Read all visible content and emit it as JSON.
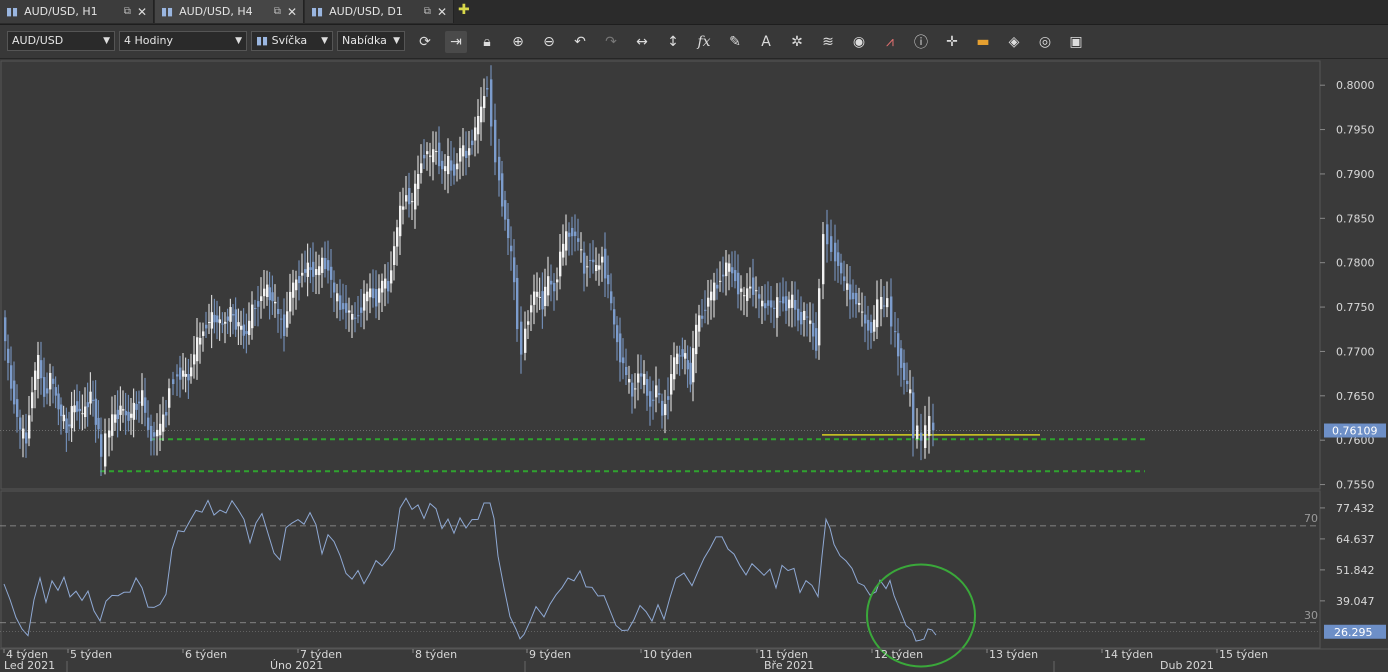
{
  "tabs": [
    {
      "label": "AUD/USD, H1"
    },
    {
      "label": "AUD/USD, H4"
    },
    {
      "label": "AUD/USD, D1"
    }
  ],
  "toolbar": {
    "symbol": "AUD/USD",
    "timeframe": "4 Hodiny",
    "chart_type": "Svíčka",
    "price_side": "Nabídka"
  },
  "chart_data": [
    {
      "type": "candlestick",
      "price_ticks": [
        "0.8000",
        "0.7950",
        "0.7900",
        "0.7850",
        "0.7800",
        "0.7750",
        "0.7700",
        "0.7650",
        "0.7600",
        "0.7550"
      ],
      "ylim": [
        0.7545,
        0.8025
      ],
      "current_price": "0.76109",
      "close_path": [
        [
          0,
          0.774
        ],
        [
          6,
          0.768
        ],
        [
          12,
          0.7645
        ],
        [
          18,
          0.761
        ],
        [
          24,
          0.76
        ],
        [
          30,
          0.766
        ],
        [
          36,
          0.769
        ],
        [
          42,
          0.765
        ],
        [
          48,
          0.7672
        ],
        [
          56,
          0.7638
        ],
        [
          64,
          0.7612
        ],
        [
          72,
          0.764
        ],
        [
          80,
          0.7628
        ],
        [
          88,
          0.7652
        ],
        [
          96,
          0.7612
        ],
        [
          100,
          0.7576
        ],
        [
          104,
          0.7602
        ],
        [
          110,
          0.7622
        ],
        [
          118,
          0.7636
        ],
        [
          126,
          0.7625
        ],
        [
          134,
          0.764
        ],
        [
          140,
          0.765
        ],
        [
          146,
          0.7608
        ],
        [
          152,
          0.7606
        ],
        [
          158,
          0.7614
        ],
        [
          164,
          0.7635
        ],
        [
          168,
          0.766
        ],
        [
          172,
          0.7672
        ],
        [
          178,
          0.7676
        ],
        [
          186,
          0.767
        ],
        [
          192,
          0.7698
        ],
        [
          198,
          0.7716
        ],
        [
          204,
          0.7732
        ],
        [
          212,
          0.7738
        ],
        [
          220,
          0.773
        ],
        [
          228,
          0.7744
        ],
        [
          236,
          0.7728
        ],
        [
          244,
          0.772
        ],
        [
          250,
          0.7746
        ],
        [
          256,
          0.7756
        ],
        [
          262,
          0.777
        ],
        [
          270,
          0.776
        ],
        [
          276,
          0.774
        ],
        [
          282,
          0.7726
        ],
        [
          288,
          0.7766
        ],
        [
          294,
          0.7778
        ],
        [
          300,
          0.779
        ],
        [
          308,
          0.7794
        ],
        [
          314,
          0.7788
        ],
        [
          320,
          0.78
        ],
        [
          326,
          0.7796
        ],
        [
          332,
          0.7764
        ],
        [
          338,
          0.7752
        ],
        [
          344,
          0.7748
        ],
        [
          350,
          0.7736
        ],
        [
          356,
          0.7742
        ],
        [
          362,
          0.776
        ],
        [
          368,
          0.7768
        ],
        [
          374,
          0.7758
        ],
        [
          380,
          0.7778
        ],
        [
          386,
          0.7772
        ],
        [
          392,
          0.782
        ],
        [
          398,
          0.7856
        ],
        [
          404,
          0.7878
        ],
        [
          410,
          0.7866
        ],
        [
          416,
          0.79
        ],
        [
          422,
          0.7926
        ],
        [
          428,
          0.7918
        ],
        [
          434,
          0.7928
        ],
        [
          440,
          0.7904
        ],
        [
          446,
          0.7912
        ],
        [
          452,
          0.7902
        ],
        [
          458,
          0.7928
        ],
        [
          464,
          0.792
        ],
        [
          470,
          0.794
        ],
        [
          476,
          0.796
        ],
        [
          482,
          0.7988
        ],
        [
          486,
          0.8004
        ],
        [
          490,
          0.7956
        ],
        [
          494,
          0.7918
        ],
        [
          500,
          0.787
        ],
        [
          506,
          0.7828
        ],
        [
          512,
          0.778
        ],
        [
          516,
          0.7728
        ],
        [
          520,
          0.7702
        ],
        [
          526,
          0.7742
        ],
        [
          532,
          0.7766
        ],
        [
          540,
          0.7756
        ],
        [
          546,
          0.778
        ],
        [
          552,
          0.777
        ],
        [
          558,
          0.7808
        ],
        [
          564,
          0.783
        ],
        [
          570,
          0.7836
        ],
        [
          576,
          0.7822
        ],
        [
          582,
          0.7792
        ],
        [
          588,
          0.7806
        ],
        [
          594,
          0.779
        ],
        [
          600,
          0.7808
        ],
        [
          606,
          0.7772
        ],
        [
          612,
          0.7728
        ],
        [
          618,
          0.7696
        ],
        [
          624,
          0.7672
        ],
        [
          630,
          0.7652
        ],
        [
          636,
          0.7676
        ],
        [
          642,
          0.7666
        ],
        [
          648,
          0.764
        ],
        [
          654,
          0.766
        ],
        [
          660,
          0.7628
        ],
        [
          666,
          0.7654
        ],
        [
          672,
          0.769
        ],
        [
          680,
          0.77
        ],
        [
          688,
          0.767
        ],
        [
          694,
          0.7728
        ],
        [
          700,
          0.7742
        ],
        [
          706,
          0.776
        ],
        [
          712,
          0.777
        ],
        [
          718,
          0.7782
        ],
        [
          724,
          0.7796
        ],
        [
          730,
          0.779
        ],
        [
          736,
          0.7772
        ],
        [
          742,
          0.776
        ],
        [
          748,
          0.7776
        ],
        [
          754,
          0.7766
        ],
        [
          760,
          0.775
        ],
        [
          766,
          0.7756
        ],
        [
          772,
          0.7746
        ],
        [
          778,
          0.776
        ],
        [
          784,
          0.7752
        ],
        [
          790,
          0.7758
        ],
        [
          796,
          0.7736
        ],
        [
          802,
          0.7742
        ],
        [
          808,
          0.773
        ],
        [
          814,
          0.7708
        ],
        [
          818,
          0.777
        ],
        [
          822,
          0.7838
        ],
        [
          826,
          0.7826
        ],
        [
          830,
          0.7816
        ],
        [
          836,
          0.78
        ],
        [
          842,
          0.7776
        ],
        [
          848,
          0.7764
        ],
        [
          854,
          0.7758
        ],
        [
          860,
          0.774
        ],
        [
          866,
          0.7726
        ],
        [
          872,
          0.773
        ],
        [
          876,
          0.7756
        ],
        [
          882,
          0.775
        ],
        [
          886,
          0.776
        ],
        [
          890,
          0.773
        ],
        [
          896,
          0.77
        ],
        [
          902,
          0.767
        ],
        [
          908,
          0.765
        ],
        [
          912,
          0.7606
        ],
        [
          916,
          0.7612
        ],
        [
          920,
          0.7596
        ],
        [
          924,
          0.7612
        ],
        [
          928,
          0.762
        ],
        [
          932,
          0.7611
        ]
      ],
      "support_levels": [
        {
          "price": 0.7601,
          "x_from": 150,
          "x_to": 1145
        },
        {
          "price": 0.7565,
          "x_from": 100,
          "x_to": 1145
        }
      ],
      "resistance_marker": {
        "price": 0.7606,
        "x_from": 822,
        "x_to": 1040
      },
      "rsi_label": "AUD/USD, H4"
    },
    {
      "type": "line",
      "indicator_ticks": [
        "77.432",
        "64.637",
        "51.842",
        "39.047"
      ],
      "ylim": [
        20,
        84
      ],
      "levels": [
        {
          "value": 70,
          "label": "70"
        },
        {
          "value": 30,
          "label": "30"
        }
      ],
      "current_value": "26.295",
      "path": [
        [
          0,
          46
        ],
        [
          6,
          38
        ],
        [
          12,
          32
        ],
        [
          18,
          29
        ],
        [
          24,
          25
        ],
        [
          30,
          38
        ],
        [
          36,
          48
        ],
        [
          42,
          40
        ],
        [
          48,
          48
        ],
        [
          54,
          42
        ],
        [
          60,
          48
        ],
        [
          66,
          42
        ],
        [
          72,
          44
        ],
        [
          78,
          38
        ],
        [
          84,
          42
        ],
        [
          90,
          36
        ],
        [
          96,
          32
        ],
        [
          102,
          38
        ],
        [
          108,
          40
        ],
        [
          114,
          42
        ],
        [
          120,
          44
        ],
        [
          126,
          42
        ],
        [
          132,
          47
        ],
        [
          138,
          45
        ],
        [
          144,
          38
        ],
        [
          150,
          36
        ],
        [
          156,
          36
        ],
        [
          162,
          42
        ],
        [
          168,
          62
        ],
        [
          174,
          68
        ],
        [
          180,
          66
        ],
        [
          186,
          72
        ],
        [
          192,
          78
        ],
        [
          198,
          76
        ],
        [
          204,
          79
        ],
        [
          210,
          74
        ],
        [
          216,
          78
        ],
        [
          222,
          76
        ],
        [
          228,
          79
        ],
        [
          234,
          76
        ],
        [
          240,
          74
        ],
        [
          246,
          64
        ],
        [
          252,
          70
        ],
        [
          258,
          74
        ],
        [
          264,
          68
        ],
        [
          270,
          60
        ],
        [
          276,
          55
        ],
        [
          282,
          68
        ],
        [
          288,
          72
        ],
        [
          294,
          74
        ],
        [
          300,
          70
        ],
        [
          306,
          74
        ],
        [
          312,
          71
        ],
        [
          318,
          60
        ],
        [
          324,
          66
        ],
        [
          330,
          62
        ],
        [
          336,
          58
        ],
        [
          342,
          52
        ],
        [
          348,
          48
        ],
        [
          354,
          50
        ],
        [
          360,
          46
        ],
        [
          366,
          52
        ],
        [
          372,
          56
        ],
        [
          378,
          52
        ],
        [
          384,
          56
        ],
        [
          390,
          62
        ],
        [
          396,
          78
        ],
        [
          402,
          80
        ],
        [
          408,
          76
        ],
        [
          414,
          80
        ],
        [
          420,
          74
        ],
        [
          426,
          78
        ],
        [
          432,
          76
        ],
        [
          438,
          70
        ],
        [
          444,
          74
        ],
        [
          450,
          66
        ],
        [
          456,
          72
        ],
        [
          462,
          70
        ],
        [
          468,
          74
        ],
        [
          474,
          72
        ],
        [
          480,
          78
        ],
        [
          486,
          80
        ],
        [
          490,
          72
        ],
        [
          494,
          56
        ],
        [
          500,
          44
        ],
        [
          506,
          34
        ],
        [
          512,
          28
        ],
        [
          516,
          25
        ],
        [
          520,
          26
        ],
        [
          526,
          32
        ],
        [
          532,
          36
        ],
        [
          540,
          34
        ],
        [
          546,
          38
        ],
        [
          552,
          40
        ],
        [
          558,
          44
        ],
        [
          564,
          50
        ],
        [
          570,
          48
        ],
        [
          576,
          50
        ],
        [
          582,
          44
        ],
        [
          588,
          46
        ],
        [
          594,
          42
        ],
        [
          600,
          40
        ],
        [
          606,
          34
        ],
        [
          612,
          30
        ],
        [
          618,
          28
        ],
        [
          624,
          26
        ],
        [
          630,
          30
        ],
        [
          636,
          38
        ],
        [
          642,
          36
        ],
        [
          648,
          30
        ],
        [
          654,
          36
        ],
        [
          660,
          32
        ],
        [
          666,
          42
        ],
        [
          672,
          48
        ],
        [
          680,
          52
        ],
        [
          688,
          44
        ],
        [
          694,
          52
        ],
        [
          700,
          58
        ],
        [
          706,
          60
        ],
        [
          712,
          64
        ],
        [
          718,
          66
        ],
        [
          724,
          62
        ],
        [
          730,
          58
        ],
        [
          736,
          52
        ],
        [
          742,
          50
        ],
        [
          748,
          56
        ],
        [
          754,
          52
        ],
        [
          760,
          48
        ],
        [
          766,
          52
        ],
        [
          772,
          46
        ],
        [
          778,
          54
        ],
        [
          784,
          50
        ],
        [
          790,
          52
        ],
        [
          796,
          44
        ],
        [
          802,
          48
        ],
        [
          808,
          44
        ],
        [
          814,
          40
        ],
        [
          818,
          56
        ],
        [
          822,
          72
        ],
        [
          826,
          70
        ],
        [
          830,
          64
        ],
        [
          836,
          58
        ],
        [
          842,
          54
        ],
        [
          848,
          52
        ],
        [
          854,
          48
        ],
        [
          860,
          46
        ],
        [
          866,
          40
        ],
        [
          872,
          42
        ],
        [
          876,
          46
        ],
        [
          882,
          44
        ],
        [
          886,
          46
        ],
        [
          890,
          40
        ],
        [
          896,
          34
        ],
        [
          902,
          30
        ],
        [
          908,
          28
        ],
        [
          912,
          24
        ],
        [
          916,
          23
        ],
        [
          920,
          22
        ],
        [
          924,
          26
        ],
        [
          928,
          27
        ],
        [
          932,
          26.3
        ]
      ]
    }
  ],
  "time_axis": {
    "weeks": [
      {
        "label": "4 týden",
        "x": 4
      },
      {
        "label": "5 týden",
        "x": 68
      },
      {
        "label": "6 týden",
        "x": 183
      },
      {
        "label": "7 týden",
        "x": 298
      },
      {
        "label": "8 týden",
        "x": 413
      },
      {
        "label": "9 týden",
        "x": 527
      },
      {
        "label": "10 týden",
        "x": 641
      },
      {
        "label": "11 týden",
        "x": 757
      },
      {
        "label": "12 týden",
        "x": 872
      },
      {
        "label": "13 týden",
        "x": 987
      },
      {
        "label": "14 týden",
        "x": 1102
      },
      {
        "label": "15 týden",
        "x": 1217
      }
    ],
    "months": [
      {
        "label": "Led 2021"
      },
      {
        "label": "Úno 2021"
      },
      {
        "label": "Bře 2021"
      },
      {
        "label": "Dub 2021"
      }
    ]
  },
  "colors": {
    "background": "#3a3a3a",
    "bull": "#f2f2f2",
    "bear": "#7c9ccc",
    "rsi_line": "#8fa9d4",
    "support": "#2fa32f",
    "resistance": "#d6d020",
    "highlight_circle": "#3aa83a",
    "price_badge": "#6d8fc7"
  }
}
